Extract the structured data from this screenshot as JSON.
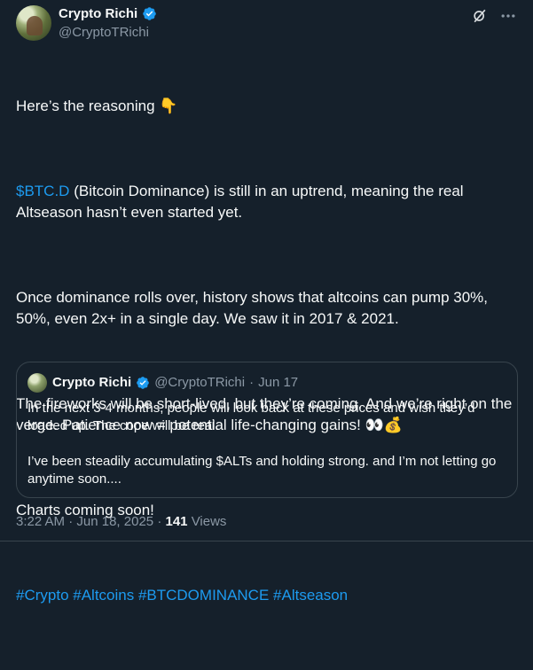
{
  "author": {
    "display_name": "Crypto Richi",
    "handle": "@CryptoTRichi"
  },
  "tweet": {
    "paragraphs": [
      "Here’s the reasoning 👇",
      "",
      "",
      "Once dominance rolls over, history shows that altcoins can pump 30%, 50%, even 2x+ in a single day. We saw it in 2017 & 2021.",
      "The fireworks will be short-lived, but they’re coming. And we’re right on the verge. Patience now = potential life-changing gains! 👀💰",
      "Charts coming soon!"
    ],
    "btc_d": "$BTC.D",
    "btc_d_rest": " (Bitcoin Dominance) is still in an uptrend, meaning the real Altseason hasn’t even started yet.",
    "hashtags": "#Crypto #Altcoins #BTCDOMINANCE #Altseason"
  },
  "quote": {
    "display_name": "Crypto Richi",
    "handle": "@CryptoTRichi",
    "dot": "·",
    "date": "Jun 17",
    "p1": "In the next 3-4 months, people will look back at these prices and wish they’d loaded up. The cope will be real.",
    "p2": "I’ve been steadily accumulating $ALTs and holding strong. and I’m not letting go anytime soon...."
  },
  "meta": {
    "time": "3:22 AM",
    "dot1": "·",
    "date": "Jun 18, 2025",
    "dot2": "·",
    "views_count": "141",
    "views_label": "Views"
  },
  "icons": {
    "verified": "verified-badge-icon",
    "grok": "grok-icon",
    "more": "more-icon"
  },
  "colors": {
    "background": "#15202b",
    "link": "#1d9bf0",
    "secondary": "#8b98a5",
    "border": "#38444d"
  }
}
